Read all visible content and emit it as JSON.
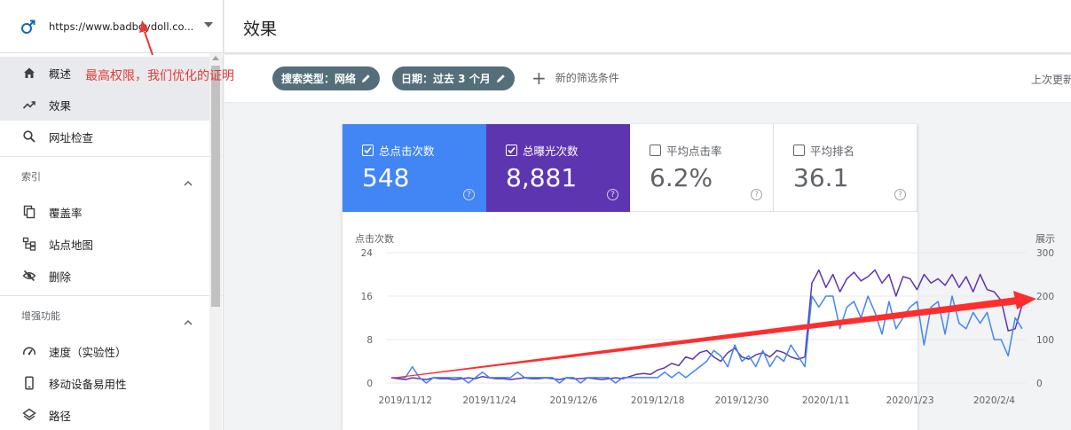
{
  "sidebar": {
    "property_url": "https://www.badboydoll.co...",
    "nav": [
      {
        "label": "概述",
        "icon": "home-icon"
      },
      {
        "label": "效果",
        "icon": "trending-up-icon"
      },
      {
        "label": "网址检查",
        "icon": "search-icon"
      }
    ],
    "sections": [
      {
        "title": "索引",
        "items": [
          {
            "label": "覆盖率",
            "icon": "copy-icon"
          },
          {
            "label": "站点地图",
            "icon": "sitemap-icon"
          },
          {
            "label": "删除",
            "icon": "eye-off-icon"
          }
        ]
      },
      {
        "title": "增强功能",
        "items": [
          {
            "label": "速度（实验性）",
            "icon": "speedometer-icon"
          },
          {
            "label": "移动设备易用性",
            "icon": "smartphone-icon"
          },
          {
            "label": "路径",
            "icon": "layers-icon"
          }
        ]
      }
    ]
  },
  "header": {
    "title": "效果"
  },
  "filters": {
    "chip_search_type": "搜索类型：网络",
    "chip_date": "日期：过去 3 个月",
    "add_filter": "新的筛选条件",
    "last_updated": "上次更新"
  },
  "annotation": "最高权限，我们优化的证明",
  "metrics": [
    {
      "label": "总点击次数",
      "value": "548",
      "checked": true,
      "color": "#4285f4"
    },
    {
      "label": "总曝光次数",
      "value": "8,881",
      "checked": true,
      "color": "#5e35b1"
    },
    {
      "label": "平均点击率",
      "value": "6.2%",
      "checked": false
    },
    {
      "label": "平均排名",
      "value": "36.1",
      "checked": false
    }
  ],
  "chart_data": {
    "type": "line",
    "x_ticks": [
      "2019/11/12",
      "2019/11/24",
      "2019/12/6",
      "2019/12/18",
      "2019/12/30",
      "2020/1/11",
      "2020/1/23",
      "2020/2/4"
    ],
    "ylabel_left": "点击次数",
    "ylabel_right": "展示",
    "left_ticks": [
      "0",
      "8",
      "16",
      "24"
    ],
    "right_ticks": [
      "0",
      "100",
      "200",
      "300"
    ],
    "ylim_left": [
      0,
      24
    ],
    "ylim_right": [
      0,
      300
    ],
    "series": [
      {
        "name": "点击次数",
        "axis": "left",
        "color": "#4285f4",
        "values": [
          1,
          1,
          1,
          3,
          1,
          0,
          1,
          1,
          1,
          1,
          1,
          0,
          1,
          2,
          1,
          1,
          1,
          1,
          2,
          1,
          1,
          1,
          1,
          1,
          0,
          1,
          1,
          0,
          1,
          1,
          1,
          1,
          0,
          1,
          1,
          1,
          1,
          1,
          1,
          2,
          1,
          2,
          1,
          2,
          3,
          4,
          6,
          5,
          3,
          7,
          4,
          5,
          3,
          6,
          3,
          5,
          4,
          7,
          5,
          3,
          16,
          14,
          16,
          16,
          10,
          14,
          15,
          12,
          16,
          13,
          9,
          15,
          10,
          12,
          14,
          15,
          7,
          14,
          15,
          9,
          16,
          11,
          10,
          13,
          11,
          13,
          8,
          8,
          5,
          12,
          10
        ]
      },
      {
        "name": "展示",
        "axis": "right",
        "color": "#5e35b1",
        "values": [
          12,
          10,
          8,
          12,
          10,
          8,
          12,
          10,
          10,
          8,
          10,
          12,
          10,
          15,
          12,
          10,
          10,
          8,
          10,
          12,
          10,
          10,
          12,
          10,
          8,
          12,
          10,
          10,
          12,
          10,
          8,
          10,
          12,
          10,
          15,
          20,
          22,
          20,
          30,
          35,
          45,
          40,
          60,
          55,
          70,
          75,
          60,
          50,
          70,
          80,
          60,
          55,
          65,
          70,
          60,
          75,
          70,
          60,
          55,
          60,
          230,
          260,
          220,
          250,
          210,
          240,
          255,
          235,
          245,
          260,
          230,
          250,
          200,
          245,
          240,
          215,
          250,
          230,
          240,
          225,
          250,
          220,
          245,
          210,
          250,
          215,
          210,
          190,
          120,
          125,
          180
        ]
      }
    ],
    "trend_arrow_color": "#ff2d2d"
  }
}
